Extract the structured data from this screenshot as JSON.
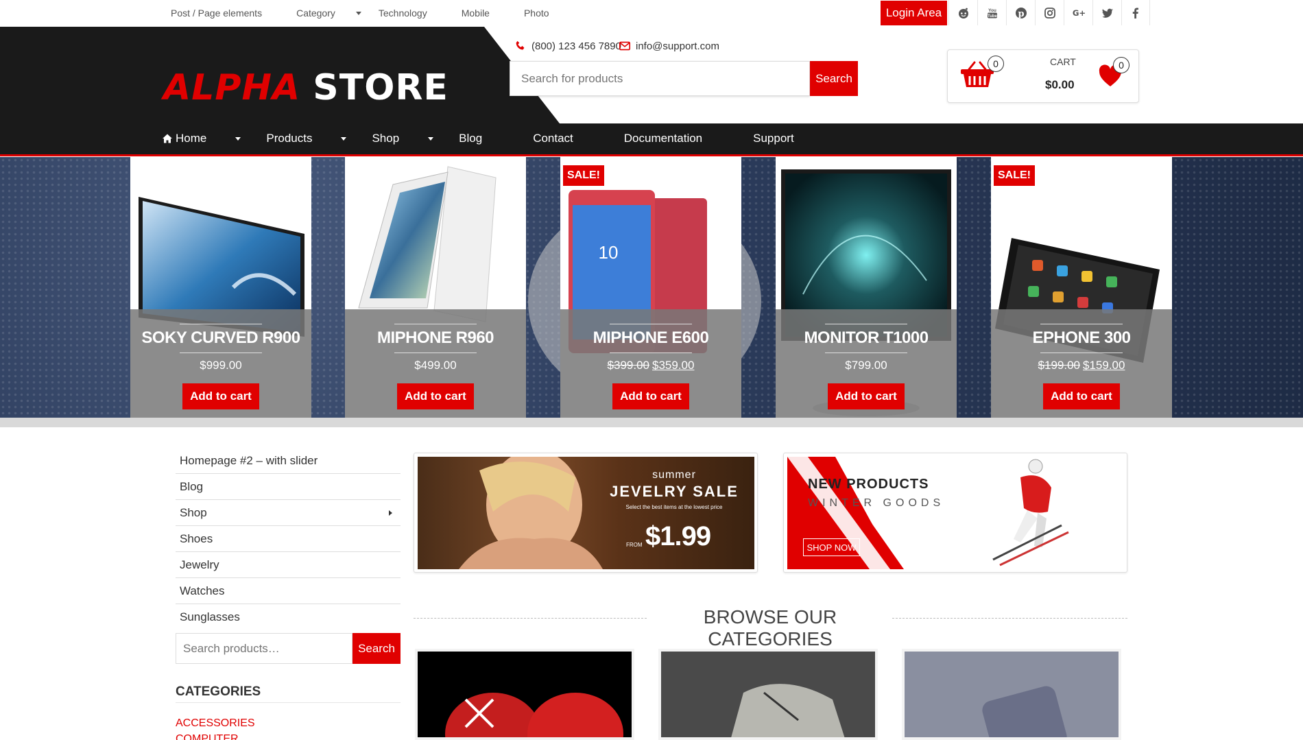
{
  "topbar": {
    "links": [
      {
        "label": "Post / Page elements",
        "dropdown": false
      },
      {
        "label": "Category",
        "dropdown": true
      },
      {
        "label": "Technology",
        "dropdown": false
      },
      {
        "label": "Mobile",
        "dropdown": false
      },
      {
        "label": "Photo",
        "dropdown": false
      }
    ],
    "login_label": "Login Area",
    "social_icons": [
      "reddit-icon",
      "youtube-icon",
      "pinterest-icon",
      "instagram-icon",
      "google-plus-icon",
      "twitter-icon",
      "facebook-icon"
    ]
  },
  "header": {
    "logo_part1": "ALPHA",
    "logo_part2": "STORE",
    "phone": "(800) 123 456 7890",
    "email": "info@support.com",
    "search_placeholder": "Search for products",
    "search_label": "Search",
    "cart_count": "0",
    "cart_label": "CART",
    "cart_total": "$0.00",
    "wishlist_count": "0"
  },
  "nav": {
    "items": [
      {
        "label": "Home",
        "dropdown": true
      },
      {
        "label": "Products",
        "dropdown": true
      },
      {
        "label": "Shop",
        "dropdown": true
      },
      {
        "label": "Blog",
        "dropdown": false
      },
      {
        "label": "Contact",
        "dropdown": false
      },
      {
        "label": "Documentation",
        "dropdown": false
      },
      {
        "label": "Support",
        "dropdown": false
      }
    ]
  },
  "slider": {
    "products": [
      {
        "name": "SOKY CURVED R900",
        "price": "$999.00",
        "old_price": "",
        "sale": false,
        "button": "Add to cart"
      },
      {
        "name": "MIPHONE R960",
        "price": "$499.00",
        "old_price": "",
        "sale": false,
        "button": "Add to cart"
      },
      {
        "name": "MIPHONE E600",
        "price": "$359.00",
        "old_price": "$399.00",
        "sale": true,
        "button": "Add to cart"
      },
      {
        "name": "MONITOR T1000",
        "price": "$799.00",
        "old_price": "",
        "sale": false,
        "button": "Add to cart"
      },
      {
        "name": "EPHONE 300",
        "price": "$159.00",
        "old_price": "$199.00",
        "sale": true,
        "button": "Add to cart"
      }
    ],
    "sale_label": "SALE!"
  },
  "sidebar": {
    "menu": [
      {
        "label": "Homepage #2 – with slider",
        "has_sub": false
      },
      {
        "label": "Blog",
        "has_sub": false
      },
      {
        "label": "Shop",
        "has_sub": true
      },
      {
        "label": "Shoes",
        "has_sub": false
      },
      {
        "label": "Jewelry",
        "has_sub": false
      },
      {
        "label": "Watches",
        "has_sub": false
      },
      {
        "label": "Sunglasses",
        "has_sub": false
      }
    ],
    "search_placeholder": "Search products…",
    "search_label": "Search",
    "categories_title": "CATEGORIES",
    "categories": [
      "ACCESSORIES",
      "COMPUTER"
    ]
  },
  "banners": {
    "jewelry": {
      "line1": "summer",
      "line2": "JEVELRY SALE",
      "line3": "Select the best items at the lowest price",
      "from": "FROM",
      "price": "$1.99"
    },
    "winter": {
      "line1": "NEW PRODUCTS",
      "line2": "WINTER GOODS",
      "cta": "SHOP NOW"
    }
  },
  "browse": {
    "title": "BROWSE OUR CATEGORIES"
  },
  "colors": {
    "accent": "#e00000",
    "dark": "#1a1a1a"
  }
}
